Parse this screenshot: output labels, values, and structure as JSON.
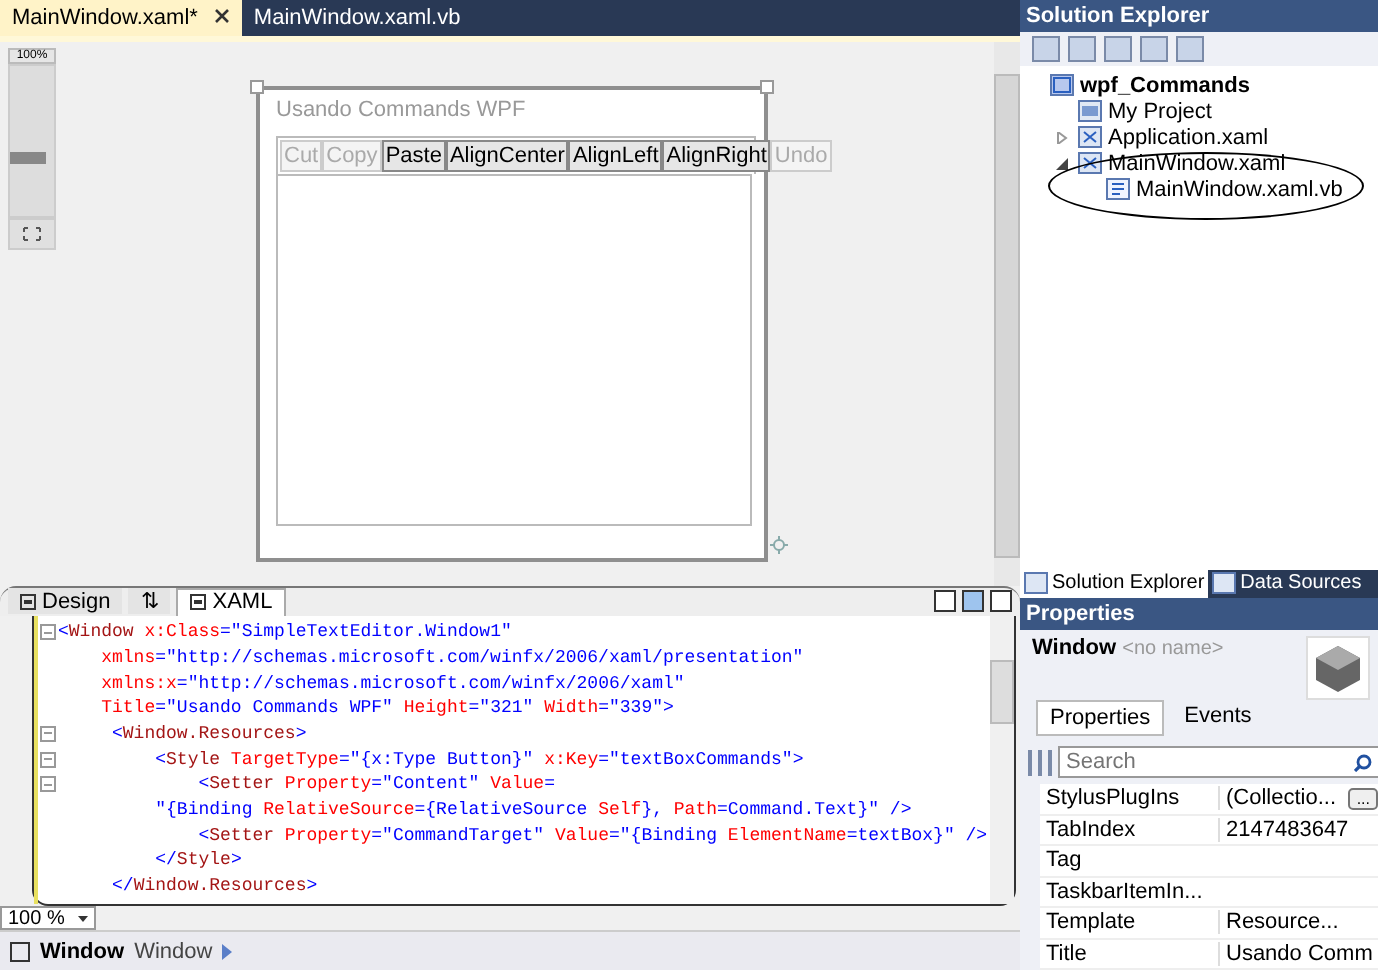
{
  "doc_tabs": [
    {
      "label": "MainWindow.xaml*",
      "selected": true
    },
    {
      "label": "MainWindow.xaml.vb",
      "selected": false
    }
  ],
  "zoom_slider": {
    "label": "100%",
    "level": 0.35
  },
  "preview_window": {
    "title": "Usando Commands WPF",
    "buttons": [
      {
        "label": "Cut",
        "enabled": false
      },
      {
        "label": "Copy",
        "enabled": false
      },
      {
        "label": "Paste",
        "enabled": true
      },
      {
        "label": "AlignCenter",
        "enabled": true
      },
      {
        "label": "AlignLeft",
        "enabled": true
      },
      {
        "label": "AlignRight",
        "enabled": true
      },
      {
        "label": "Undo",
        "enabled": false
      }
    ]
  },
  "view_tabs": [
    {
      "label": "Design",
      "kind": "design",
      "selected": false
    },
    {
      "label": "⇅",
      "kind": "swap",
      "selected": false
    },
    {
      "label": "XAML",
      "kind": "xaml",
      "selected": true
    }
  ],
  "code_lines": [
    {
      "fold": true,
      "tokens": [
        {
          "kind": "punct",
          "text": "<"
        },
        {
          "kind": "tag",
          "text": "Window"
        },
        {
          "kind": "attr",
          "text": " x:Class"
        },
        {
          "kind": "punct",
          "text": "=\""
        },
        {
          "kind": "value",
          "text": "SimpleTextEditor.Window1"
        },
        {
          "kind": "punct",
          "text": "\""
        }
      ]
    },
    {
      "fold": false,
      "tokens": [
        {
          "kind": "attr",
          "text": "    xmlns"
        },
        {
          "kind": "punct",
          "text": "=\""
        },
        {
          "kind": "value",
          "text": "http://schemas.microsoft.com/winfx/2006/xaml/presentation"
        },
        {
          "kind": "punct",
          "text": "\""
        }
      ]
    },
    {
      "fold": false,
      "tokens": [
        {
          "kind": "attr",
          "text": "    xmlns:x"
        },
        {
          "kind": "punct",
          "text": "=\""
        },
        {
          "kind": "value",
          "text": "http://schemas.microsoft.com/winfx/2006/xaml"
        },
        {
          "kind": "punct",
          "text": "\""
        }
      ]
    },
    {
      "fold": false,
      "tokens": [
        {
          "kind": "attr",
          "text": "    Title"
        },
        {
          "kind": "punct",
          "text": "=\""
        },
        {
          "kind": "value",
          "text": "Usando Commands WPF"
        },
        {
          "kind": "punct",
          "text": "\""
        },
        {
          "kind": "attr",
          "text": " Height"
        },
        {
          "kind": "punct",
          "text": "=\""
        },
        {
          "kind": "value",
          "text": "321"
        },
        {
          "kind": "punct",
          "text": "\""
        },
        {
          "kind": "attr",
          "text": " Width"
        },
        {
          "kind": "punct",
          "text": "=\""
        },
        {
          "kind": "value",
          "text": "339"
        },
        {
          "kind": "punct",
          "text": "\">"
        }
      ]
    },
    {
      "fold": true,
      "tokens": [
        {
          "kind": "punct",
          "text": "     <"
        },
        {
          "kind": "tag",
          "text": "Window.Resources"
        },
        {
          "kind": "punct",
          "text": ">"
        }
      ]
    },
    {
      "fold": true,
      "tokens": [
        {
          "kind": "punct",
          "text": "         <"
        },
        {
          "kind": "tag",
          "text": "Style"
        },
        {
          "kind": "attr",
          "text": " TargetType"
        },
        {
          "kind": "punct",
          "text": "=\""
        },
        {
          "kind": "value",
          "text": "{x:Type Button}"
        },
        {
          "kind": "punct",
          "text": "\""
        },
        {
          "kind": "attr",
          "text": " x:Key"
        },
        {
          "kind": "punct",
          "text": "=\""
        },
        {
          "kind": "value",
          "text": "textBoxCommands"
        },
        {
          "kind": "punct",
          "text": "\">"
        }
      ]
    },
    {
      "fold": true,
      "tokens": [
        {
          "kind": "punct",
          "text": "             <"
        },
        {
          "kind": "tag",
          "text": "Setter"
        },
        {
          "kind": "attr",
          "text": " Property"
        },
        {
          "kind": "punct",
          "text": "=\""
        },
        {
          "kind": "value",
          "text": "Content"
        },
        {
          "kind": "punct",
          "text": "\""
        },
        {
          "kind": "attr",
          "text": " Value"
        },
        {
          "kind": "punct",
          "text": "="
        }
      ]
    },
    {
      "fold": false,
      "tokens": [
        {
          "kind": "punct",
          "text": "         \""
        },
        {
          "kind": "value",
          "text": "{Binding "
        },
        {
          "kind": "attr",
          "text": "RelativeSource"
        },
        {
          "kind": "value",
          "text": "={RelativeSource "
        },
        {
          "kind": "attr",
          "text": "Self"
        },
        {
          "kind": "value",
          "text": "}, "
        },
        {
          "kind": "attr",
          "text": "Path"
        },
        {
          "kind": "value",
          "text": "=Command.Text}"
        },
        {
          "kind": "punct",
          "text": "\" />"
        }
      ]
    },
    {
      "fold": false,
      "tokens": [
        {
          "kind": "punct",
          "text": "             <"
        },
        {
          "kind": "tag",
          "text": "Setter"
        },
        {
          "kind": "attr",
          "text": " Property"
        },
        {
          "kind": "punct",
          "text": "=\""
        },
        {
          "kind": "value",
          "text": "CommandTarget"
        },
        {
          "kind": "punct",
          "text": "\""
        },
        {
          "kind": "attr",
          "text": " Value"
        },
        {
          "kind": "punct",
          "text": "=\""
        },
        {
          "kind": "value",
          "text": "{Binding "
        },
        {
          "kind": "attr",
          "text": "ElementName"
        },
        {
          "kind": "value",
          "text": "=textBox}"
        },
        {
          "kind": "punct",
          "text": "\" />"
        }
      ]
    },
    {
      "fold": false,
      "tokens": [
        {
          "kind": "punct",
          "text": "         </"
        },
        {
          "kind": "tag",
          "text": "Style"
        },
        {
          "kind": "punct",
          "text": ">"
        }
      ]
    },
    {
      "fold": false,
      "tokens": [
        {
          "kind": "punct",
          "text": "     </"
        },
        {
          "kind": "tag",
          "text": "Window.Resources"
        },
        {
          "kind": "punct",
          "text": ">"
        }
      ]
    }
  ],
  "zoom_combo": {
    "value": "100 %"
  },
  "breadcrumb": {
    "element": "Window",
    "type": "Window"
  },
  "solution_explorer": {
    "title": "Solution Explorer",
    "tree": [
      {
        "label": "wpf_Commands",
        "kind": "solution",
        "children": [
          {
            "label": "My Project",
            "kind": "project"
          },
          {
            "label": "Application.xaml",
            "kind": "xaml",
            "expanded": false
          },
          {
            "label": "MainWindow.xaml",
            "kind": "xaml",
            "expanded": true,
            "children": [
              {
                "label": "MainWindow.xaml.vb",
                "kind": "vb"
              }
            ]
          }
        ]
      }
    ]
  },
  "bottom_tabs": [
    {
      "label": "Solution Explorer",
      "selected": true
    },
    {
      "label": "Data Sources",
      "selected": false
    }
  ],
  "properties": {
    "title": "Properties",
    "element_type": "Window",
    "element_name": "<no name>",
    "tabs": [
      {
        "label": "Properties",
        "selected": true
      },
      {
        "label": "Events",
        "selected": false
      }
    ],
    "search_placeholder": "Search",
    "rows": [
      {
        "name": "StylusPlugIns",
        "value": "(Collectio...",
        "button_label": "..."
      },
      {
        "name": "TabIndex",
        "value": "2147483647"
      },
      {
        "name": "Tag"
      },
      {
        "name": "TaskbarItemIn..."
      },
      {
        "name": "Template",
        "value": "Resource..."
      },
      {
        "name": "Title",
        "value": "Usando Comm"
      }
    ]
  }
}
